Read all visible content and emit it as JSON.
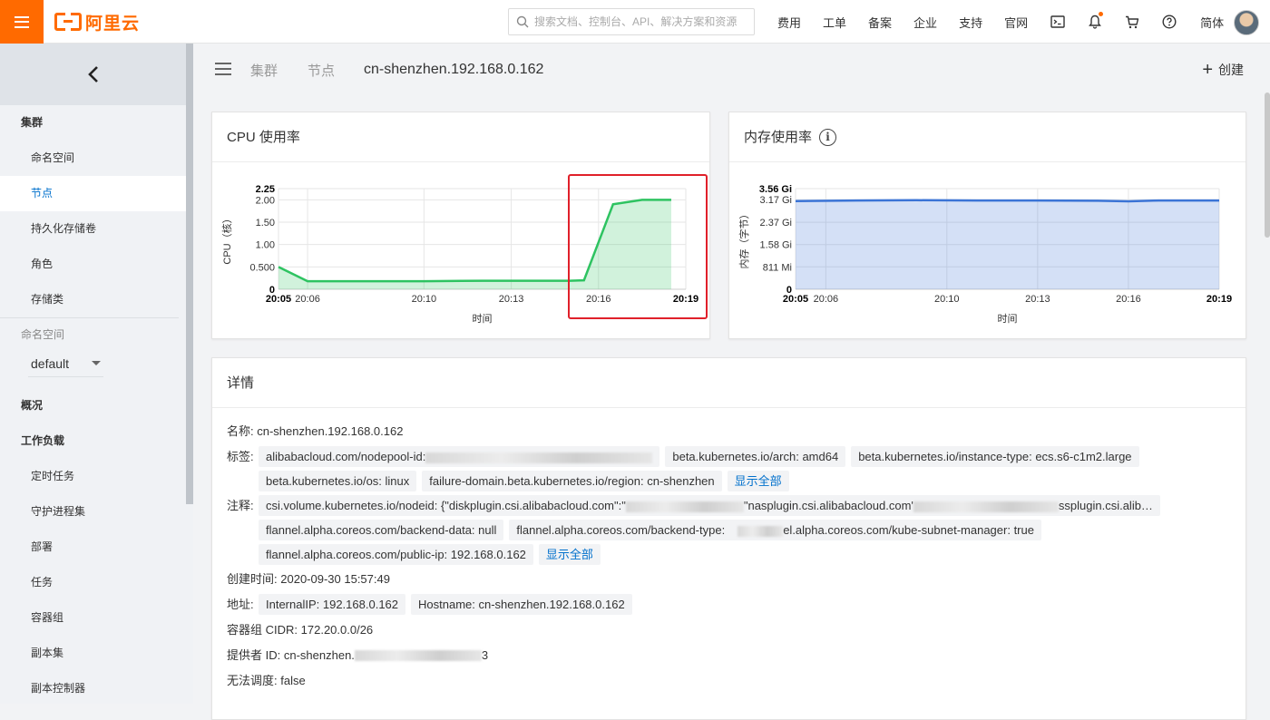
{
  "topbar": {
    "logo_text": "阿里云",
    "search_placeholder": "搜索文档、控制台、API、解决方案和资源",
    "nav": [
      "费用",
      "工单",
      "备案",
      "企业",
      "支持",
      "官网"
    ],
    "lang": "简体"
  },
  "sidebar": {
    "group1": "集群",
    "items1": [
      "命名空间",
      "节点",
      "持久化存储卷",
      "角色",
      "存储类"
    ],
    "ns_label": "命名空间",
    "ns_value": "default",
    "group2": "概况",
    "group3": "工作负载",
    "items3": [
      "定时任务",
      "守护进程集",
      "部署",
      "任务",
      "容器组",
      "副本集",
      "副本控制器"
    ]
  },
  "header": {
    "crumb1": "集群",
    "crumb2": "节点",
    "title": "cn-shenzhen.192.168.0.162",
    "create": "创建"
  },
  "cpu_card": {
    "title": "CPU 使用率"
  },
  "mem_card": {
    "title": "内存使用率",
    "info_icon": "i"
  },
  "chart_data": [
    {
      "type": "area",
      "title": "CPU 使用率",
      "xlabel": "时间",
      "ylabel": "CPU（核）",
      "x_ticks": [
        "20:05",
        "20:06",
        "20:10",
        "20:13",
        "20:16",
        "20:19"
      ],
      "y_ticks": [
        "0",
        "0.500",
        "1.00",
        "1.50",
        "2.00",
        "2.25"
      ],
      "ylim": [
        0,
        2.25
      ],
      "color": "#2ec361",
      "series": [
        {
          "name": "",
          "x": [
            "20:05",
            "20:06",
            "20:08",
            "20:10",
            "20:12",
            "20:13",
            "20:15",
            "20:15.5",
            "20:16.5",
            "20:17.5",
            "20:18.5"
          ],
          "values": [
            0.5,
            0.18,
            0.18,
            0.18,
            0.19,
            0.19,
            0.19,
            0.2,
            1.9,
            2.0,
            2.0
          ]
        }
      ]
    },
    {
      "type": "area",
      "title": "内存使用率",
      "xlabel": "时间",
      "ylabel": "内存（字节）",
      "x_ticks": [
        "20:05",
        "20:06",
        "20:10",
        "20:13",
        "20:16",
        "20:19"
      ],
      "y_ticks": [
        "0",
        "811 Mi",
        "1.58 Gi",
        "2.37 Gi",
        "3.17 Gi",
        "3.56 Gi"
      ],
      "ylim": [
        0,
        3.56
      ],
      "color": "#3b74d6",
      "series": [
        {
          "name": "",
          "x": [
            "20:05",
            "20:07",
            "20:09",
            "20:11",
            "20:13",
            "20:15",
            "20:16",
            "20:17",
            "20:19"
          ],
          "values": [
            3.12,
            3.14,
            3.15,
            3.14,
            3.14,
            3.13,
            3.11,
            3.14,
            3.14
          ]
        }
      ]
    }
  ],
  "detail": {
    "title": "详情",
    "name_label": "名称:",
    "name_value": "cn-shenzhen.192.168.0.162",
    "labels_label": "标签:",
    "labels": [
      "alibabacloud.com/nodepool-id:",
      "beta.kubernetes.io/arch: amd64",
      "beta.kubernetes.io/instance-type: ecs.s6-c1m2.large",
      "beta.kubernetes.io/os: linux",
      "failure-domain.beta.kubernetes.io/region: cn-shenzhen"
    ],
    "show_all": "显示全部",
    "annotations_label": "注释:",
    "annotations": [
      "csi.volume.kubernetes.io/nodeid:  {\"diskplugin.csi.alibabacloud.com\":\"",
      "flannel.alpha.coreos.com/backend-data:  null",
      "flannel.alpha.coreos.com/backend-type:",
      "el.alpha.coreos.com/kube-subnet-manager:  true",
      "flannel.alpha.coreos.com/public-ip:  192.168.0.162"
    ],
    "annotation1_mid": "\"nasplugin.csi.alibabacloud.com'",
    "annotation1_tail": "ssplugin.csi.alib…",
    "created_label": "创建时间:",
    "created_value": "2020-09-30 15:57:49",
    "address_label": "地址:",
    "addresses": [
      "InternalIP: 192.168.0.162",
      "Hostname: cn-shenzhen.192.168.0.162"
    ],
    "cidr_label": "容器组 CIDR:",
    "cidr_value": "172.20.0.0/26",
    "provider_label": "提供者 ID:",
    "provider_value": "cn-shenzhen.",
    "provider_tail": "3",
    "unsched_label": "无法调度:",
    "unsched_value": "false"
  }
}
